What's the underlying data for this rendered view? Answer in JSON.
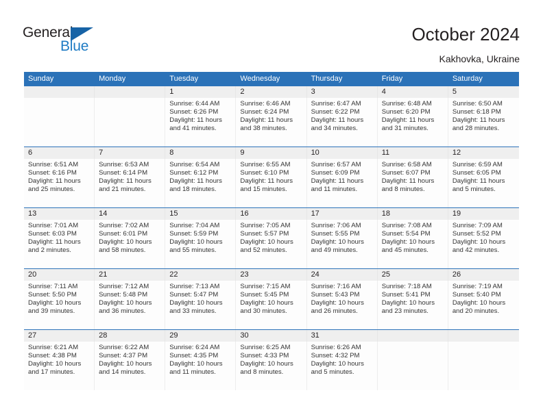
{
  "logo": {
    "word_one": "General",
    "word_two": "Blue",
    "triangle_color": "#1763a6",
    "blue_color": "#1e7bc4"
  },
  "header": {
    "title": "October 2024",
    "location": "Kakhovka, Ukraine",
    "header_bg": "#2b72b8"
  },
  "weekdays": [
    "Sunday",
    "Monday",
    "Tuesday",
    "Wednesday",
    "Thursday",
    "Friday",
    "Saturday"
  ],
  "weeks": [
    [
      {
        "day": "",
        "sunrise": "",
        "sunset": "",
        "daylight1": "",
        "daylight2": ""
      },
      {
        "day": "",
        "sunrise": "",
        "sunset": "",
        "daylight1": "",
        "daylight2": ""
      },
      {
        "day": "1",
        "sunrise": "Sunrise: 6:44 AM",
        "sunset": "Sunset: 6:26 PM",
        "daylight1": "Daylight: 11 hours",
        "daylight2": "and 41 minutes."
      },
      {
        "day": "2",
        "sunrise": "Sunrise: 6:46 AM",
        "sunset": "Sunset: 6:24 PM",
        "daylight1": "Daylight: 11 hours",
        "daylight2": "and 38 minutes."
      },
      {
        "day": "3",
        "sunrise": "Sunrise: 6:47 AM",
        "sunset": "Sunset: 6:22 PM",
        "daylight1": "Daylight: 11 hours",
        "daylight2": "and 34 minutes."
      },
      {
        "day": "4",
        "sunrise": "Sunrise: 6:48 AM",
        "sunset": "Sunset: 6:20 PM",
        "daylight1": "Daylight: 11 hours",
        "daylight2": "and 31 minutes."
      },
      {
        "day": "5",
        "sunrise": "Sunrise: 6:50 AM",
        "sunset": "Sunset: 6:18 PM",
        "daylight1": "Daylight: 11 hours",
        "daylight2": "and 28 minutes."
      }
    ],
    [
      {
        "day": "6",
        "sunrise": "Sunrise: 6:51 AM",
        "sunset": "Sunset: 6:16 PM",
        "daylight1": "Daylight: 11 hours",
        "daylight2": "and 25 minutes."
      },
      {
        "day": "7",
        "sunrise": "Sunrise: 6:53 AM",
        "sunset": "Sunset: 6:14 PM",
        "daylight1": "Daylight: 11 hours",
        "daylight2": "and 21 minutes."
      },
      {
        "day": "8",
        "sunrise": "Sunrise: 6:54 AM",
        "sunset": "Sunset: 6:12 PM",
        "daylight1": "Daylight: 11 hours",
        "daylight2": "and 18 minutes."
      },
      {
        "day": "9",
        "sunrise": "Sunrise: 6:55 AM",
        "sunset": "Sunset: 6:10 PM",
        "daylight1": "Daylight: 11 hours",
        "daylight2": "and 15 minutes."
      },
      {
        "day": "10",
        "sunrise": "Sunrise: 6:57 AM",
        "sunset": "Sunset: 6:09 PM",
        "daylight1": "Daylight: 11 hours",
        "daylight2": "and 11 minutes."
      },
      {
        "day": "11",
        "sunrise": "Sunrise: 6:58 AM",
        "sunset": "Sunset: 6:07 PM",
        "daylight1": "Daylight: 11 hours",
        "daylight2": "and 8 minutes."
      },
      {
        "day": "12",
        "sunrise": "Sunrise: 6:59 AM",
        "sunset": "Sunset: 6:05 PM",
        "daylight1": "Daylight: 11 hours",
        "daylight2": "and 5 minutes."
      }
    ],
    [
      {
        "day": "13",
        "sunrise": "Sunrise: 7:01 AM",
        "sunset": "Sunset: 6:03 PM",
        "daylight1": "Daylight: 11 hours",
        "daylight2": "and 2 minutes."
      },
      {
        "day": "14",
        "sunrise": "Sunrise: 7:02 AM",
        "sunset": "Sunset: 6:01 PM",
        "daylight1": "Daylight: 10 hours",
        "daylight2": "and 58 minutes."
      },
      {
        "day": "15",
        "sunrise": "Sunrise: 7:04 AM",
        "sunset": "Sunset: 5:59 PM",
        "daylight1": "Daylight: 10 hours",
        "daylight2": "and 55 minutes."
      },
      {
        "day": "16",
        "sunrise": "Sunrise: 7:05 AM",
        "sunset": "Sunset: 5:57 PM",
        "daylight1": "Daylight: 10 hours",
        "daylight2": "and 52 minutes."
      },
      {
        "day": "17",
        "sunrise": "Sunrise: 7:06 AM",
        "sunset": "Sunset: 5:55 PM",
        "daylight1": "Daylight: 10 hours",
        "daylight2": "and 49 minutes."
      },
      {
        "day": "18",
        "sunrise": "Sunrise: 7:08 AM",
        "sunset": "Sunset: 5:54 PM",
        "daylight1": "Daylight: 10 hours",
        "daylight2": "and 45 minutes."
      },
      {
        "day": "19",
        "sunrise": "Sunrise: 7:09 AM",
        "sunset": "Sunset: 5:52 PM",
        "daylight1": "Daylight: 10 hours",
        "daylight2": "and 42 minutes."
      }
    ],
    [
      {
        "day": "20",
        "sunrise": "Sunrise: 7:11 AM",
        "sunset": "Sunset: 5:50 PM",
        "daylight1": "Daylight: 10 hours",
        "daylight2": "and 39 minutes."
      },
      {
        "day": "21",
        "sunrise": "Sunrise: 7:12 AM",
        "sunset": "Sunset: 5:48 PM",
        "daylight1": "Daylight: 10 hours",
        "daylight2": "and 36 minutes."
      },
      {
        "day": "22",
        "sunrise": "Sunrise: 7:13 AM",
        "sunset": "Sunset: 5:47 PM",
        "daylight1": "Daylight: 10 hours",
        "daylight2": "and 33 minutes."
      },
      {
        "day": "23",
        "sunrise": "Sunrise: 7:15 AM",
        "sunset": "Sunset: 5:45 PM",
        "daylight1": "Daylight: 10 hours",
        "daylight2": "and 30 minutes."
      },
      {
        "day": "24",
        "sunrise": "Sunrise: 7:16 AM",
        "sunset": "Sunset: 5:43 PM",
        "daylight1": "Daylight: 10 hours",
        "daylight2": "and 26 minutes."
      },
      {
        "day": "25",
        "sunrise": "Sunrise: 7:18 AM",
        "sunset": "Sunset: 5:41 PM",
        "daylight1": "Daylight: 10 hours",
        "daylight2": "and 23 minutes."
      },
      {
        "day": "26",
        "sunrise": "Sunrise: 7:19 AM",
        "sunset": "Sunset: 5:40 PM",
        "daylight1": "Daylight: 10 hours",
        "daylight2": "and 20 minutes."
      }
    ],
    [
      {
        "day": "27",
        "sunrise": "Sunrise: 6:21 AM",
        "sunset": "Sunset: 4:38 PM",
        "daylight1": "Daylight: 10 hours",
        "daylight2": "and 17 minutes."
      },
      {
        "day": "28",
        "sunrise": "Sunrise: 6:22 AM",
        "sunset": "Sunset: 4:37 PM",
        "daylight1": "Daylight: 10 hours",
        "daylight2": "and 14 minutes."
      },
      {
        "day": "29",
        "sunrise": "Sunrise: 6:24 AM",
        "sunset": "Sunset: 4:35 PM",
        "daylight1": "Daylight: 10 hours",
        "daylight2": "and 11 minutes."
      },
      {
        "day": "30",
        "sunrise": "Sunrise: 6:25 AM",
        "sunset": "Sunset: 4:33 PM",
        "daylight1": "Daylight: 10 hours",
        "daylight2": "and 8 minutes."
      },
      {
        "day": "31",
        "sunrise": "Sunrise: 6:26 AM",
        "sunset": "Sunset: 4:32 PM",
        "daylight1": "Daylight: 10 hours",
        "daylight2": "and 5 minutes."
      },
      {
        "day": "",
        "sunrise": "",
        "sunset": "",
        "daylight1": "",
        "daylight2": ""
      },
      {
        "day": "",
        "sunrise": "",
        "sunset": "",
        "daylight1": "",
        "daylight2": ""
      }
    ]
  ]
}
